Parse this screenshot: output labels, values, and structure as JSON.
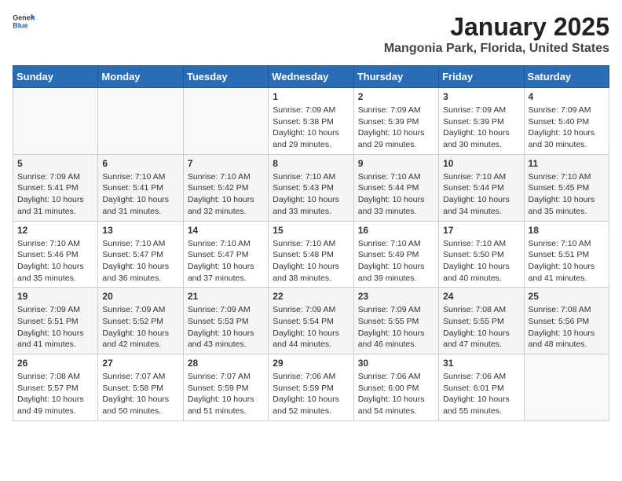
{
  "header": {
    "logo_general": "General",
    "logo_blue": "Blue",
    "month_title": "January 2025",
    "location": "Mangonia Park, Florida, United States"
  },
  "days_of_week": [
    "Sunday",
    "Monday",
    "Tuesday",
    "Wednesday",
    "Thursday",
    "Friday",
    "Saturday"
  ],
  "weeks": [
    [
      {
        "day": "",
        "info": ""
      },
      {
        "day": "",
        "info": ""
      },
      {
        "day": "",
        "info": ""
      },
      {
        "day": "1",
        "info": "Sunrise: 7:09 AM\nSunset: 5:38 PM\nDaylight: 10 hours and 29 minutes."
      },
      {
        "day": "2",
        "info": "Sunrise: 7:09 AM\nSunset: 5:39 PM\nDaylight: 10 hours and 29 minutes."
      },
      {
        "day": "3",
        "info": "Sunrise: 7:09 AM\nSunset: 5:39 PM\nDaylight: 10 hours and 30 minutes."
      },
      {
        "day": "4",
        "info": "Sunrise: 7:09 AM\nSunset: 5:40 PM\nDaylight: 10 hours and 30 minutes."
      }
    ],
    [
      {
        "day": "5",
        "info": "Sunrise: 7:09 AM\nSunset: 5:41 PM\nDaylight: 10 hours and 31 minutes."
      },
      {
        "day": "6",
        "info": "Sunrise: 7:10 AM\nSunset: 5:41 PM\nDaylight: 10 hours and 31 minutes."
      },
      {
        "day": "7",
        "info": "Sunrise: 7:10 AM\nSunset: 5:42 PM\nDaylight: 10 hours and 32 minutes."
      },
      {
        "day": "8",
        "info": "Sunrise: 7:10 AM\nSunset: 5:43 PM\nDaylight: 10 hours and 33 minutes."
      },
      {
        "day": "9",
        "info": "Sunrise: 7:10 AM\nSunset: 5:44 PM\nDaylight: 10 hours and 33 minutes."
      },
      {
        "day": "10",
        "info": "Sunrise: 7:10 AM\nSunset: 5:44 PM\nDaylight: 10 hours and 34 minutes."
      },
      {
        "day": "11",
        "info": "Sunrise: 7:10 AM\nSunset: 5:45 PM\nDaylight: 10 hours and 35 minutes."
      }
    ],
    [
      {
        "day": "12",
        "info": "Sunrise: 7:10 AM\nSunset: 5:46 PM\nDaylight: 10 hours and 35 minutes."
      },
      {
        "day": "13",
        "info": "Sunrise: 7:10 AM\nSunset: 5:47 PM\nDaylight: 10 hours and 36 minutes."
      },
      {
        "day": "14",
        "info": "Sunrise: 7:10 AM\nSunset: 5:47 PM\nDaylight: 10 hours and 37 minutes."
      },
      {
        "day": "15",
        "info": "Sunrise: 7:10 AM\nSunset: 5:48 PM\nDaylight: 10 hours and 38 minutes."
      },
      {
        "day": "16",
        "info": "Sunrise: 7:10 AM\nSunset: 5:49 PM\nDaylight: 10 hours and 39 minutes."
      },
      {
        "day": "17",
        "info": "Sunrise: 7:10 AM\nSunset: 5:50 PM\nDaylight: 10 hours and 40 minutes."
      },
      {
        "day": "18",
        "info": "Sunrise: 7:10 AM\nSunset: 5:51 PM\nDaylight: 10 hours and 41 minutes."
      }
    ],
    [
      {
        "day": "19",
        "info": "Sunrise: 7:09 AM\nSunset: 5:51 PM\nDaylight: 10 hours and 41 minutes."
      },
      {
        "day": "20",
        "info": "Sunrise: 7:09 AM\nSunset: 5:52 PM\nDaylight: 10 hours and 42 minutes."
      },
      {
        "day": "21",
        "info": "Sunrise: 7:09 AM\nSunset: 5:53 PM\nDaylight: 10 hours and 43 minutes."
      },
      {
        "day": "22",
        "info": "Sunrise: 7:09 AM\nSunset: 5:54 PM\nDaylight: 10 hours and 44 minutes."
      },
      {
        "day": "23",
        "info": "Sunrise: 7:09 AM\nSunset: 5:55 PM\nDaylight: 10 hours and 46 minutes."
      },
      {
        "day": "24",
        "info": "Sunrise: 7:08 AM\nSunset: 5:55 PM\nDaylight: 10 hours and 47 minutes."
      },
      {
        "day": "25",
        "info": "Sunrise: 7:08 AM\nSunset: 5:56 PM\nDaylight: 10 hours and 48 minutes."
      }
    ],
    [
      {
        "day": "26",
        "info": "Sunrise: 7:08 AM\nSunset: 5:57 PM\nDaylight: 10 hours and 49 minutes."
      },
      {
        "day": "27",
        "info": "Sunrise: 7:07 AM\nSunset: 5:58 PM\nDaylight: 10 hours and 50 minutes."
      },
      {
        "day": "28",
        "info": "Sunrise: 7:07 AM\nSunset: 5:59 PM\nDaylight: 10 hours and 51 minutes."
      },
      {
        "day": "29",
        "info": "Sunrise: 7:06 AM\nSunset: 5:59 PM\nDaylight: 10 hours and 52 minutes."
      },
      {
        "day": "30",
        "info": "Sunrise: 7:06 AM\nSunset: 6:00 PM\nDaylight: 10 hours and 54 minutes."
      },
      {
        "day": "31",
        "info": "Sunrise: 7:06 AM\nSunset: 6:01 PM\nDaylight: 10 hours and 55 minutes."
      },
      {
        "day": "",
        "info": ""
      }
    ]
  ]
}
